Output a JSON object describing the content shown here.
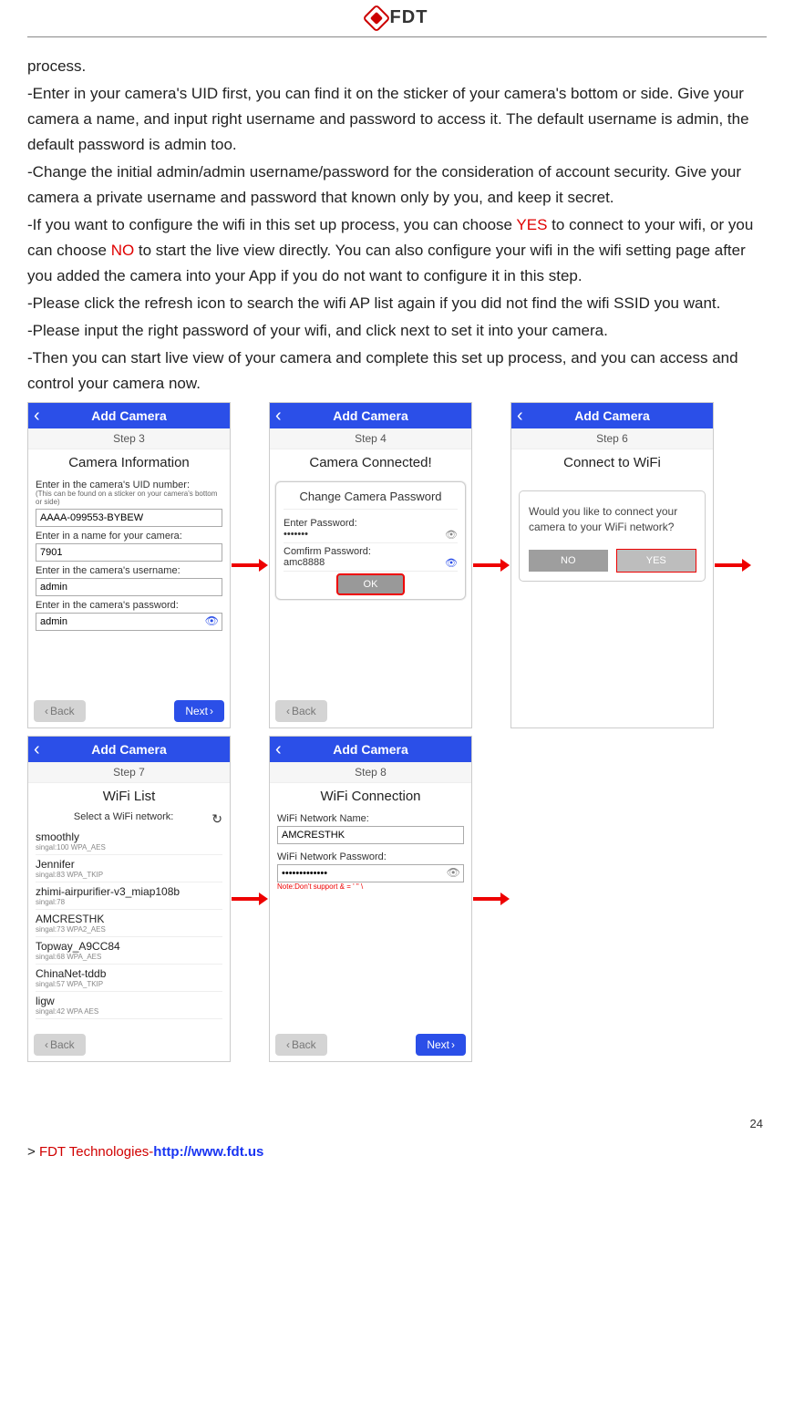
{
  "header": {
    "brand": "FDT"
  },
  "text": {
    "p0": "process.",
    "p1_a": "-Enter in your camera's UID first, you can find it on the sticker of your camera's bottom or side. Give your camera a name, and input right username and password to access it. The default username is admin, the default password is admin too.",
    "p2": "-Change the initial admin/admin username/password for the consideration of account security. Give your camera a private username and password that known only by you, and keep it secret.",
    "p3_a": "-If you want to configure the wifi in this set up process, you can choose ",
    "p3_yes": "YES",
    "p3_b": " to connect to your wifi, or you can choose ",
    "p3_no": "NO",
    "p3_c": " to start the live view directly. You can also configure your wifi in the wifi setting page after you added the camera into your App if you do not want to configure it in this step.",
    "p4": "-Please click the refresh icon to search the wifi AP list again if you did not find the wifi SSID you want.",
    "p5": "-Please input the right password of your wifi, and click next to set it into your camera.",
    "p6": "-Then you can start live view of your camera and complete this set up process, and you can access and control your camera now."
  },
  "common": {
    "headerTitle": "Add Camera",
    "back": "Back",
    "next": "Next"
  },
  "screen3": {
    "step": "Step 3",
    "title": "Camera Information",
    "l_uid": "Enter in the camera's UID number:",
    "l_uid_hint": "(This can be found on a sticker on your camera's bottom or side)",
    "v_uid": "AAAA-099553-BYBEW",
    "l_name": "Enter in a name for your camera:",
    "v_name": "7901",
    "l_user": "Enter in the camera's username:",
    "v_user": "admin",
    "l_pass": "Enter in the camera's password:",
    "v_pass": "admin"
  },
  "screen4": {
    "step": "Step 4",
    "title": "Camera Connected!",
    "modalTitle": "Change Camera Password",
    "l_enter": "Enter Password:",
    "v_enter": "•••••••",
    "l_confirm": "Comfirm Password:",
    "v_confirm": "amc8888",
    "ok": "OK"
  },
  "screen6": {
    "step": "Step 6",
    "title": "Connect to WiFi",
    "question": "Would you like to connect your camera to your WiFi network?",
    "no": "NO",
    "yes": "YES"
  },
  "screen7": {
    "step": "Step 7",
    "title": "WiFi List",
    "selectLabel": "Select a WiFi network:",
    "items": [
      {
        "name": "smoothly",
        "meta": "singal:100   WPA_AES"
      },
      {
        "name": "Jennifer",
        "meta": "singal:83   WPA_TKIP"
      },
      {
        "name": "zhimi-airpurifier-v3_miap108b",
        "meta": "singal:78"
      },
      {
        "name": "AMCRESTHK",
        "meta": "singal:73   WPA2_AES"
      },
      {
        "name": "Topway_A9CC84",
        "meta": "singal:68   WPA_AES"
      },
      {
        "name": "ChinaNet-tddb",
        "meta": "singal:57   WPA_TKIP"
      },
      {
        "name": "ligw",
        "meta": "singal:42   WPA AES"
      }
    ]
  },
  "screen8": {
    "step": "Step 8",
    "title": "WiFi Connection",
    "l_name": "WiFi Network Name:",
    "v_name": "AMCRESTHK",
    "l_pass": "WiFi Network Password:",
    "v_pass": "•••••••••••••",
    "note": "Note:Don't support & = ' \" \\"
  },
  "footer": {
    "company": "FDT Technologies-",
    "url": "http://www.fdt.us",
    "page": "24"
  }
}
